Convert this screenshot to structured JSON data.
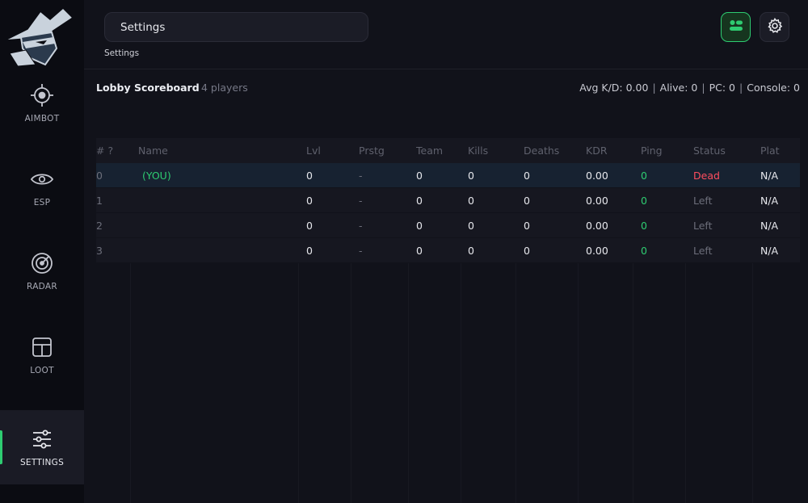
{
  "sidebar": {
    "items": [
      {
        "label": "AIMBOT",
        "icon": "crosshair-icon"
      },
      {
        "label": "ESP",
        "icon": "eye-icon"
      },
      {
        "label": "RADAR",
        "icon": "radar-icon"
      },
      {
        "label": "LOOT",
        "icon": "loot-layout-icon"
      },
      {
        "label": "SETTINGS",
        "icon": "sliders-icon"
      }
    ],
    "active": "SETTINGS"
  },
  "header": {
    "search_value": "Settings",
    "breadcrumb": "Settings"
  },
  "scoreboard": {
    "title": "Lobby Scoreboard",
    "count": "4 players",
    "stats": {
      "avg_kd": "Avg K/D: 0.00",
      "alive": "Alive: 0",
      "pc": "PC: 0",
      "console": "Console: 0",
      "separator": "|"
    },
    "columns": [
      "# ?",
      "Name",
      "Lvl",
      "Prstg",
      "Team",
      "Kills",
      "Deaths",
      "KDR",
      "Ping",
      "Status",
      "Plat"
    ],
    "rows": [
      {
        "idx": "0",
        "name": "(YOU)",
        "lvl": "0",
        "prstg": "-",
        "team": "0",
        "kills": "0",
        "deaths": "0",
        "kdr": "0.00",
        "ping": "0",
        "status": "Dead",
        "plat": "N/A"
      },
      {
        "idx": "1",
        "name": "",
        "lvl": "0",
        "prstg": "-",
        "team": "0",
        "kills": "0",
        "deaths": "0",
        "kdr": "0.00",
        "ping": "0",
        "status": "Left",
        "plat": "N/A"
      },
      {
        "idx": "2",
        "name": "",
        "lvl": "0",
        "prstg": "-",
        "team": "0",
        "kills": "0",
        "deaths": "0",
        "kdr": "0.00",
        "ping": "0",
        "status": "Left",
        "plat": "N/A"
      },
      {
        "idx": "3",
        "name": "",
        "lvl": "0",
        "prstg": "-",
        "team": "0",
        "kills": "0",
        "deaths": "0",
        "kdr": "0.00",
        "ping": "0",
        "status": "Left",
        "plat": "N/A"
      }
    ]
  },
  "colors": {
    "accent": "#2ecc71",
    "dead": "#ff4d5e",
    "self_row": "#172231"
  }
}
